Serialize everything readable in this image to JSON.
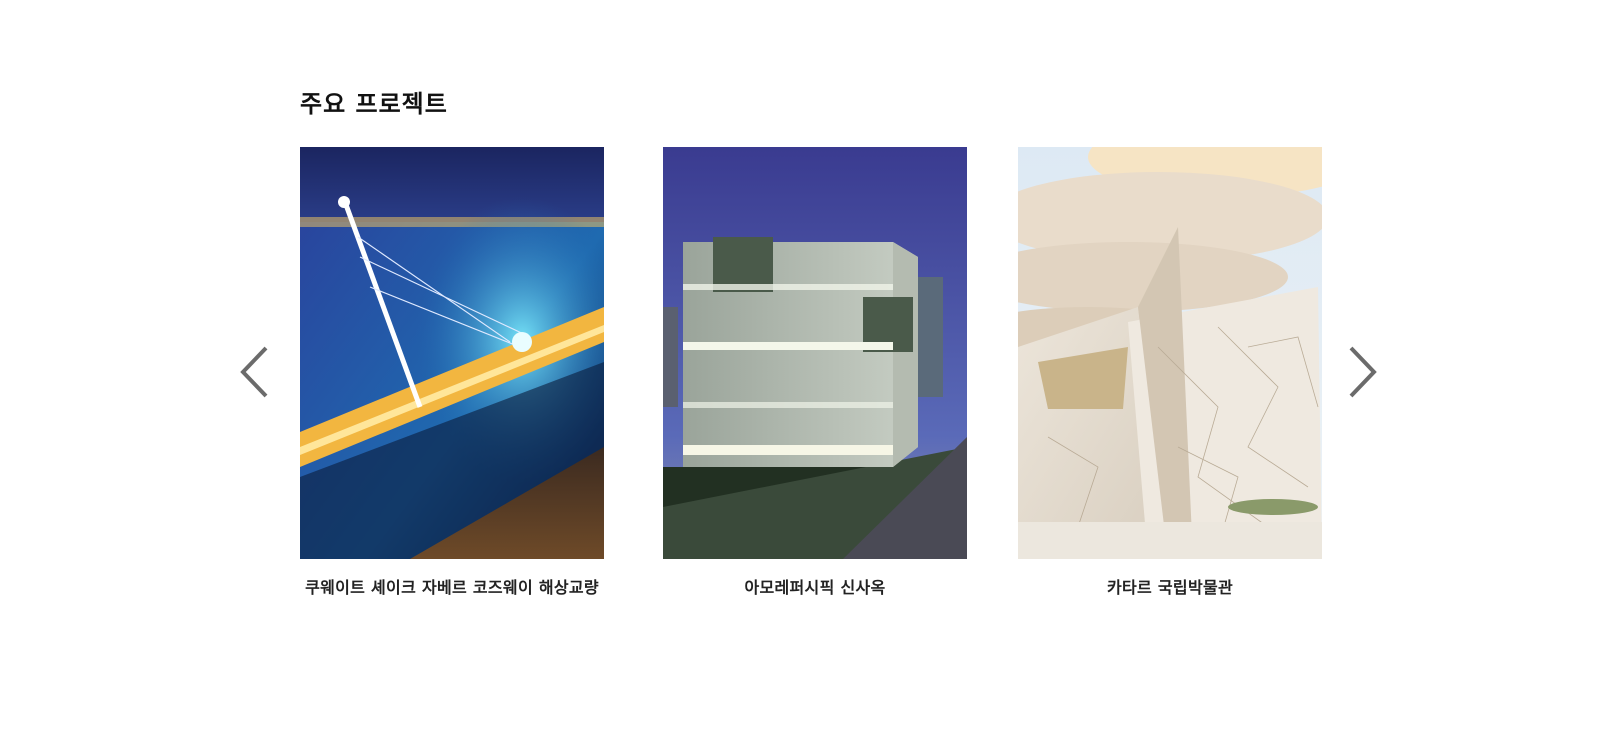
{
  "section": {
    "title": "주요 프로젝트"
  },
  "carousel": {
    "prev_icon": "chevron-left-icon",
    "next_icon": "chevron-right-icon",
    "arrow_color": "#6b6b6b",
    "items": [
      {
        "caption": "쿠웨이트 셰이크 자베르 코즈웨이 해상교량",
        "image": "night cable-stayed sea bridge"
      },
      {
        "caption": "아모레퍼시픽 신사옥",
        "image": "lit cube office tower at dusk"
      },
      {
        "caption": "카타르 국립박물관",
        "image": "desert rose disc-shaped museum facade"
      }
    ]
  }
}
